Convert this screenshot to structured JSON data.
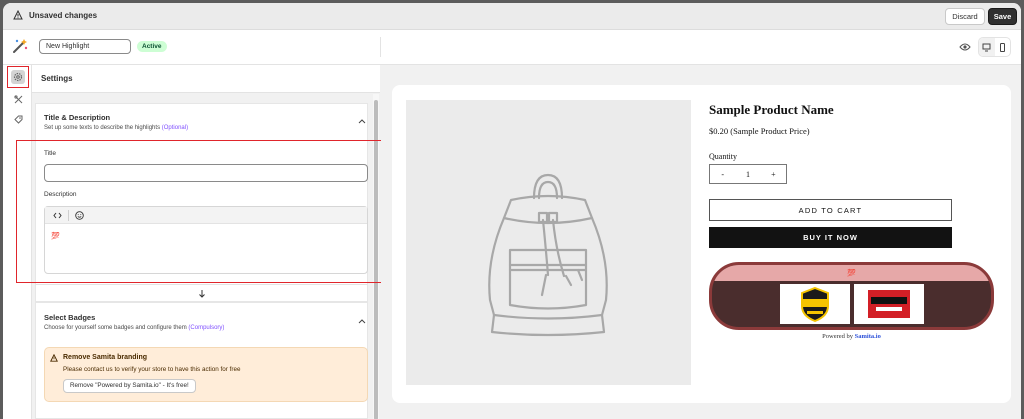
{
  "topbar": {
    "status": "Unsaved changes",
    "discard_label": "Discard",
    "save_label": "Save"
  },
  "subbar": {
    "name_value": "New Highlight",
    "status_badge": "Active"
  },
  "rail": {
    "items": [
      "gear-icon",
      "tools-icon",
      "tag-icon"
    ]
  },
  "settings": {
    "title": "Settings",
    "title_section": {
      "heading": "Title & Description",
      "subtitle": "Set up some texts to describe the highlights",
      "subtitle_tag": "(Optional)",
      "title_label": "Title",
      "title_value": "",
      "description_label": "Description",
      "editor_emoji": "💯"
    },
    "badges_section": {
      "heading": "Select Badges",
      "subtitle": "Choose for yourself some badges and configure them",
      "subtitle_tag": "(Compulsory)",
      "callout_title": "Remove Samita branding",
      "callout_text": "Please contact us to verify your store to have this action for free",
      "callout_button": "Remove \"Powered by Samita.io\" - It's free!"
    }
  },
  "preview": {
    "product_name": "Sample Product Name",
    "price": "$0.20 (Sample Product Price)",
    "quantity_label": "Quantity",
    "qty_minus": "-",
    "qty_value": "1",
    "qty_plus": "+",
    "add_to_cart": "ADD TO CART",
    "buy_now": "BUY IT NOW",
    "widget_emoji": "💯",
    "powered_prefix": "Powered by",
    "powered_brand": "Samita.io"
  },
  "colors": {
    "accent_red": "#e0252b",
    "widget_frame": "#8b3a3a",
    "widget_bg": "#4a2d2d",
    "widget_header": "#e6a8a8",
    "active_badge": "#cdfed4"
  }
}
